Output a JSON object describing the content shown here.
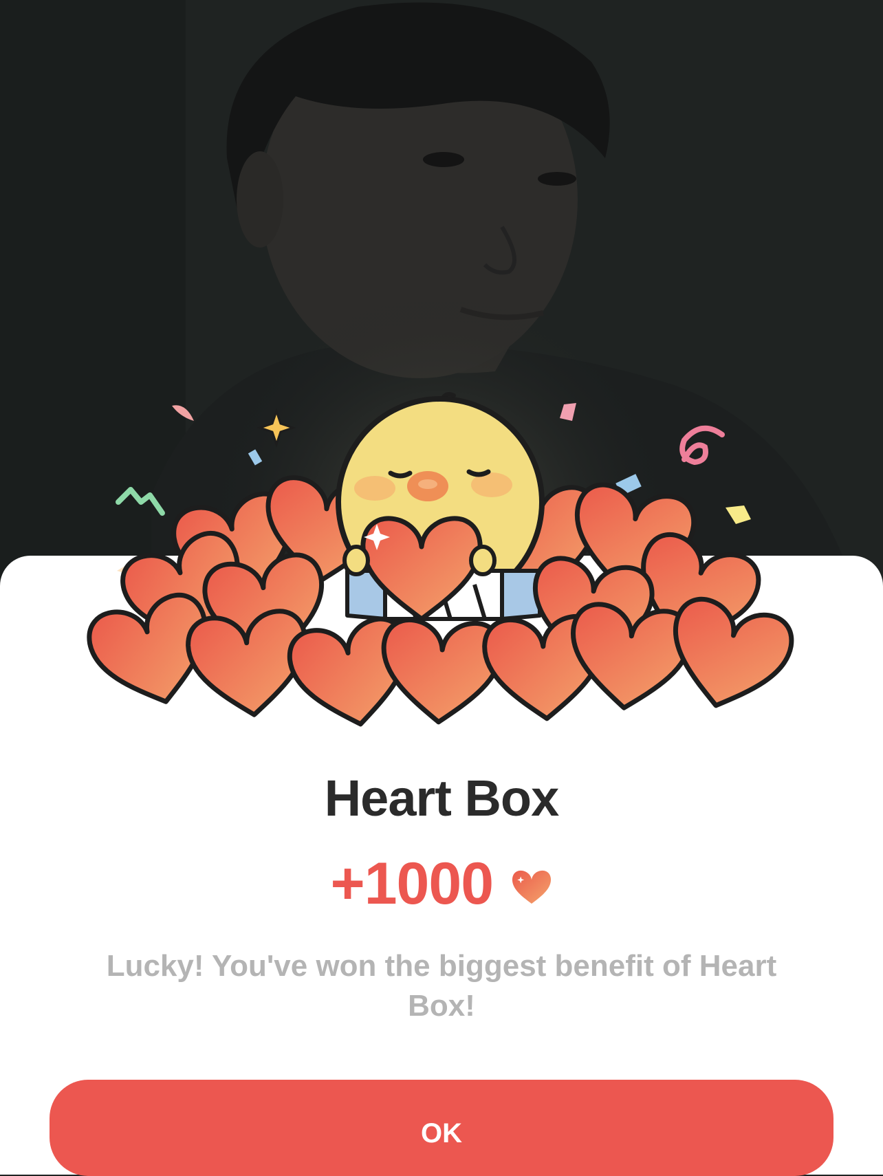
{
  "dialog": {
    "title": "Heart Box",
    "amount": "+1000",
    "message": "Lucky! You've won the biggest benefit of Heart Box!",
    "ok_label": "OK"
  },
  "icons": {
    "amount_icon": "heart-icon",
    "mascot": "chick-mascot-icon"
  },
  "colors": {
    "accent": "#ec5750",
    "title": "#2b2b2b",
    "message": "#b4b4b4",
    "background_dim": "#1f2322"
  }
}
